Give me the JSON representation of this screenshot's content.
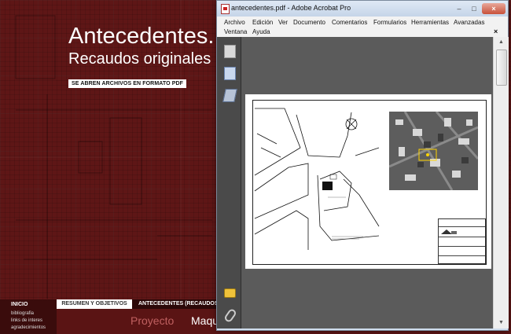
{
  "site": {
    "title": "Antecedentes.",
    "subtitle": "Recaudos originales",
    "pdf_note": "SE ABREN ARCHIVOS EN FORMATO PDF",
    "nav": {
      "inicio": "INICIO",
      "items": [
        "bibliografia",
        "links de interes",
        "agradecimientos"
      ]
    },
    "tabs": {
      "resumen": "RESUMEN Y OBJETIVOS",
      "antecedentes": "ANTECEDENTES (RECAUDOS O"
    },
    "links": {
      "proyecto": "Proyecto",
      "maqueta": "Maque"
    }
  },
  "acrobat": {
    "window_title": "antecedentes.pdf - Adobe Acrobat Pro",
    "window_buttons": {
      "minimize": "–",
      "maximize": "□",
      "close": "×"
    },
    "menu": {
      "row1": [
        "Archivo",
        "Edición",
        "Ver",
        "Documento",
        "Comentarios",
        "Formularios",
        "Herramientas",
        "Avanzadas"
      ],
      "row2": [
        "Ventana",
        "Ayuda"
      ],
      "close_doc": "×"
    },
    "tool_icons": [
      "pages-icon",
      "bookmarks-icon",
      "signatures-icon",
      "comments-icon",
      "attachment-icon"
    ],
    "scroll": {
      "up": "▲",
      "down": "▼"
    }
  },
  "colors": {
    "site_background": "#5e1616",
    "acrobat_doc_background": "#5b5b5b",
    "close_button": "#c8513a"
  }
}
